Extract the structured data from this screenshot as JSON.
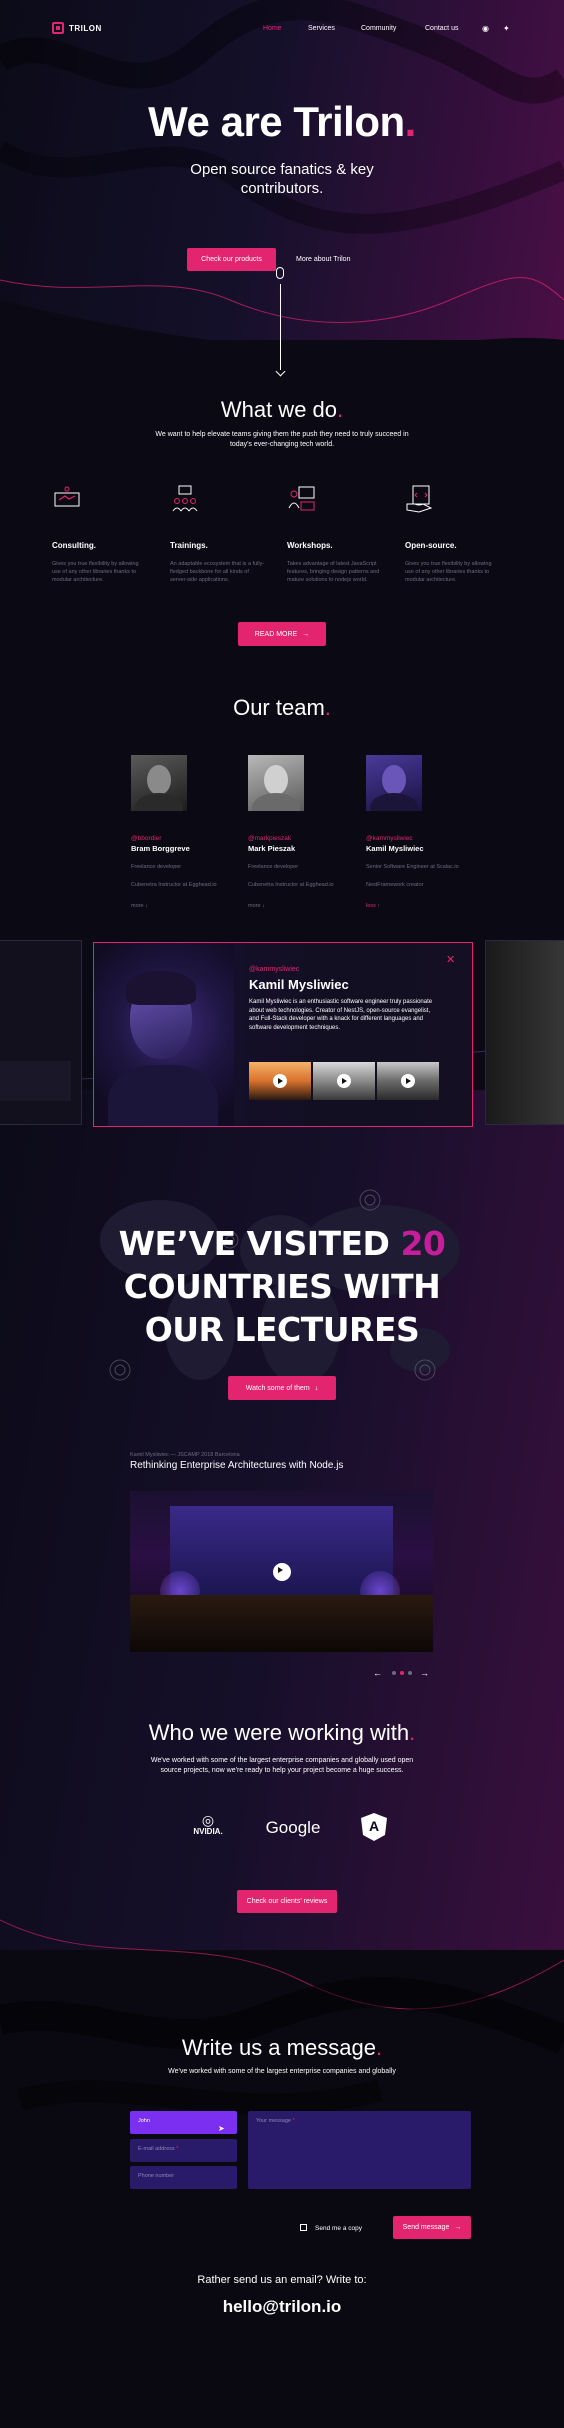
{
  "colors": {
    "accent": "#e3246e",
    "purple": "#7b2ff0",
    "field": "#2a1a6a",
    "background": "#0b0a14"
  },
  "nav": {
    "logo": "TRILON",
    "links": [
      "Home",
      "Services",
      "Community",
      "Contact us"
    ],
    "icons": [
      "github-icon",
      "twitter-icon"
    ]
  },
  "hero": {
    "title": "We are Trilon",
    "title_dot": ".",
    "subtitle": "Open source fanatics & key contributors.",
    "primary_cta": "Check our products",
    "secondary_cta": "More about Trilon"
  },
  "what_we_do": {
    "title": "What we do",
    "dot": ".",
    "subtitle": "We want to help elevate teams giving them the push they need to truly succeed in today's ever-changing tech world.",
    "services": [
      {
        "title": "Consulting.",
        "icon": "handshake-icon",
        "desc": "Gives you true flexibility by allowing use of any other libraries thanks to modular architecture."
      },
      {
        "title": "Trainings.",
        "icon": "audience-icon",
        "desc": "An adaptable ecosystem that is a fully-fledged backbone for all kinds of server-side applications."
      },
      {
        "title": "Workshops.",
        "icon": "presenter-icon",
        "desc": "Takes advantage of latest JavaScript features, bringing design patterns and mature solutions to nodejs world."
      },
      {
        "title": "Open-source.",
        "icon": "code-hand-icon",
        "desc": "Gives you true flexibility by allowing use of any other libraries thanks to modular architecture."
      }
    ],
    "cta": "READ MORE"
  },
  "team": {
    "title": "Our team",
    "dot": ".",
    "members": [
      {
        "handle": "@bbordier",
        "name": "Bram Borggreve",
        "role": "Freelance developer",
        "company": "Cubenetra Instructor at Egghead.io",
        "more": "more"
      },
      {
        "handle": "@markpieszak",
        "name": "Mark Pieszak",
        "role": "Freelance developer",
        "company": "Cubenetra Instructor at Egghead.io",
        "more": "more"
      },
      {
        "handle": "@kammysliwiec",
        "name": "Kamil Mysliwiec",
        "role": "Senior Software Engineer at Scalac.io",
        "company": "NestFramework creator",
        "more": "less"
      }
    ]
  },
  "profile": {
    "handle": "@kammysliwiec",
    "name": "Kamil Mysliwiec",
    "bio": "Kamil Mysliwiec is an enthusiastic software engineer truly passionate about web technologies. Creator of NestJS, open-source evangelist, and Full-Stack developer with a knack for different languages and software development techniques.",
    "videos": 3
  },
  "visited": {
    "line1_a": "WE’VE VISITED",
    "number": "20",
    "line2": "COUNTRIES WITH",
    "line3": "OUR LECTURES",
    "cta": "Watch some of them",
    "talk_meta": "Kamil Mysliwiec  —  JSCAMP 2018 Barcelona",
    "talk_title": "Rethinking Enterprise Architectures with Node.js",
    "carousel_active": 2,
    "carousel_total": 3
  },
  "clients": {
    "title": "Who we were working with",
    "dot": ".",
    "subtitle": "We've worked with some of the largest enterprise companies and globally used open source projects, now we're ready to help your project become a huge success.",
    "logos": [
      "NVIDIA.",
      "Google",
      "A"
    ],
    "cta": "Check our clients' reviews"
  },
  "contact": {
    "title": "Write us a message",
    "dot": ".",
    "subtitle": "We've worked with some of the largest enterprise companies and globally",
    "name_value": "John",
    "email_label": "E-mail address",
    "phone_label": "Phone number",
    "message_label": "Your message",
    "copy_label": "Send me a copy",
    "submit": "Send message",
    "email_prompt": "Rather send us an email? Write to:",
    "email": "hello@trilon.io"
  }
}
